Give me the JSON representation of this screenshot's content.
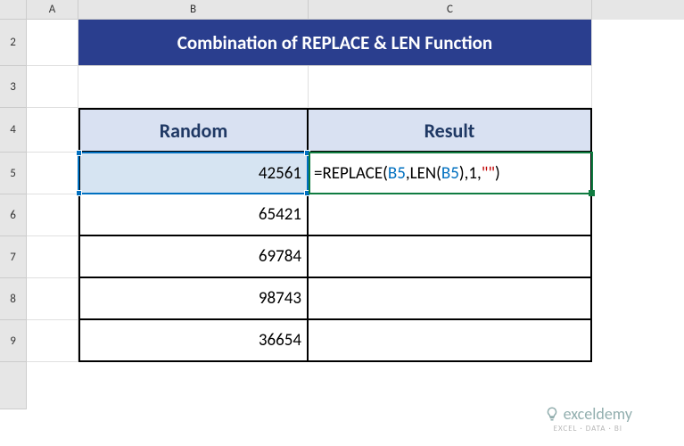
{
  "columns": {
    "A": "A",
    "B": "B",
    "C": "C"
  },
  "rows": {
    "r2": "2",
    "r3": "3",
    "r4": "4",
    "r5": "5",
    "r6": "6",
    "r7": "7",
    "r8": "8",
    "r9": "9"
  },
  "title": "Combination of REPLACE & LEN Function",
  "headers": {
    "random": "Random",
    "result": "Result"
  },
  "data": {
    "b5": "42561",
    "b6": "65421",
    "b7": "69784",
    "b8": "98743",
    "b9": "36654"
  },
  "formula": {
    "p1": "=REPLACE(",
    "p2": "B5",
    "p3": ",LEN(",
    "p4": "B5",
    "p5": "),",
    "p6": "1",
    "p7": ",",
    "p8": "\"\"",
    "p9": ")"
  },
  "watermark": {
    "brand": "exceldemy",
    "tag": "EXCEL · DATA · BI"
  }
}
